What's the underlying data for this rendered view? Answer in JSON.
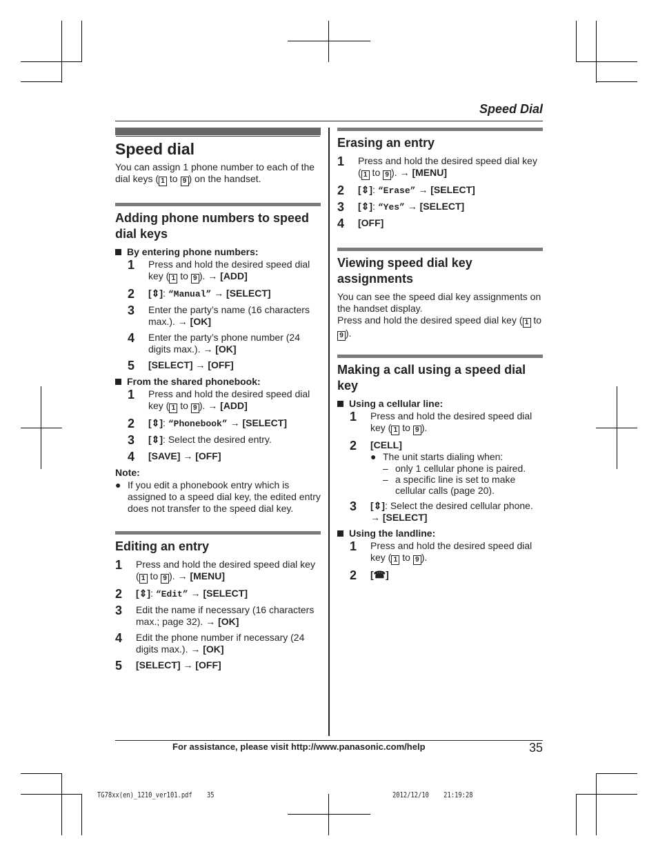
{
  "header": {
    "section": "Speed Dial"
  },
  "left": {
    "title": "Speed dial",
    "intro_a": "You can assign 1 phone number to each of the dial keys (",
    "intro_b": " to ",
    "intro_c": ") on the handset.",
    "key1": "1",
    "key9": "9",
    "add_title": "Adding phone numbers to speed dial keys",
    "sub1": "By entering phone numbers:",
    "sub2": "From the shared phonebook:",
    "press_hold": "Press and hold the desired speed dial key (",
    "to": " to ",
    "close_paren": ").",
    "arrow": "→",
    "ud": "[⇕]",
    "add": "[ADD]",
    "select": "[SELECT]",
    "ok": "[OK]",
    "off": "[OFF]",
    "save": "[SAVE]",
    "menu": "[MENU]",
    "manual": "“Manual”",
    "phonebook": "“Phonebook”",
    "edit": "“Edit”",
    "colon": ": ",
    "s3_name": "Enter the party’s name (16 characters max.).",
    "s4_number": "Enter the party’s phone number (24 digits max.).",
    "select_entry": ": Select the desired entry.",
    "note": "Note:",
    "note_text": "If you edit a phonebook entry which is assigned to a speed dial key, the edited entry does not transfer to the speed dial key.",
    "edit_title": "Editing an entry",
    "e3": "Edit the name if necessary (16 characters max.; page 32).",
    "e4": "Edit the phone number if necessary (24 digits max.)."
  },
  "right": {
    "erase_title": "Erasing an entry",
    "erase": "“Erase”",
    "yes": "“Yes”",
    "view_title": "Viewing speed dial key assignments",
    "view_p1": "You can see the speed dial key assignments on the handset display.",
    "view_p2": "Press and hold the desired speed dial key (",
    "call_title": "Making a call using a speed dial key",
    "sub_cell": "Using a cellular line:",
    "sub_land": "Using the landline:",
    "cell": "[CELL]",
    "starts": "The unit starts dialing when:",
    "d1": "only 1 cellular phone is paired.",
    "d2": "a specific line is set to make cellular calls (page 20).",
    "select_cell": ": Select the desired cellular phone.",
    "talk": "[☎]"
  },
  "footer": {
    "help": "For assistance, please visit http://www.panasonic.com/help",
    "page": "35",
    "slug_file": "TG78xx(en)_1210_ver101.pdf    35",
    "slug_date": "2012/12/10    21:19:28"
  }
}
